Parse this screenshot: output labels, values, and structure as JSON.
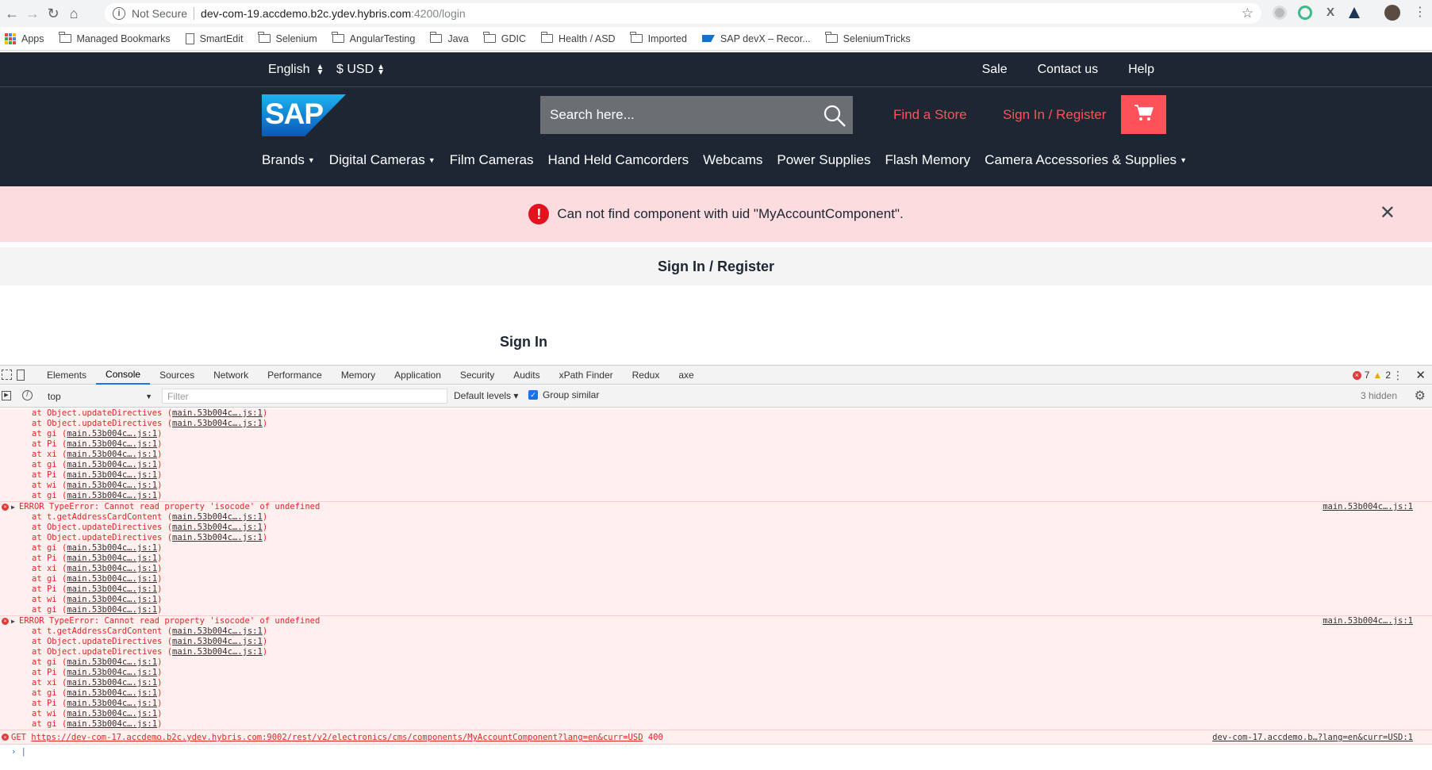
{
  "browser": {
    "security_label": "Not Secure",
    "url_host": "dev-com-19.accdemo.b2c.ydev.hybris.com",
    "url_path": ":4200/login",
    "bookmarks": [
      "Apps",
      "Managed Bookmarks",
      "SmartEdit",
      "Selenium",
      "AngularTesting",
      "Java",
      "GDIC",
      "Health / ASD",
      "Imported",
      "SAP devX – Recor...",
      "SeleniumTricks"
    ]
  },
  "site": {
    "language": "English",
    "currency": "$ USD",
    "top_links": [
      "Sale",
      "Contact us",
      "Help"
    ],
    "logo_text": "SAP",
    "search_placeholder": "Search here...",
    "find_store": "Find a Store",
    "sign_in_register": "Sign In / Register",
    "categories": [
      {
        "label": "Brands",
        "dropdown": true
      },
      {
        "label": "Digital Cameras",
        "dropdown": true
      },
      {
        "label": "Film Cameras",
        "dropdown": false
      },
      {
        "label": "Hand Held Camcorders",
        "dropdown": false
      },
      {
        "label": "Webcams",
        "dropdown": false
      },
      {
        "label": "Power Supplies",
        "dropdown": false
      },
      {
        "label": "Flash Memory",
        "dropdown": false
      },
      {
        "label": "Camera Accessories & Supplies",
        "dropdown": true
      }
    ],
    "alert_message": "Can not find component with uid \"MyAccountComponent\".",
    "page_title": "Sign In / Register",
    "section_heading": "Sign In"
  },
  "devtools": {
    "tabs": [
      "Elements",
      "Console",
      "Sources",
      "Network",
      "Performance",
      "Memory",
      "Application",
      "Security",
      "Audits",
      "xPath Finder",
      "Redux",
      "axe"
    ],
    "active_tab": "Console",
    "error_count": "7",
    "warning_count": "2",
    "context": "top",
    "filter_placeholder": "Filter",
    "levels": "Default levels ▾",
    "group_similar": "Group similar",
    "hidden": "3 hidden",
    "colors": {
      "error": "#e02828",
      "accent": "#1a73e8"
    },
    "console": {
      "partial_block": [
        {
          "fn": "Object.updateDirectives",
          "src": "main.53b004c….js:1"
        },
        {
          "fn": "Object.updateDirectives",
          "src": "main.53b004c….js:1"
        },
        {
          "fn": "gi",
          "src": "main.53b004c….js:1"
        },
        {
          "fn": "Pi",
          "src": "main.53b004c….js:1"
        },
        {
          "fn": "xi",
          "src": "main.53b004c….js:1"
        },
        {
          "fn": "gi",
          "src": "main.53b004c….js:1"
        },
        {
          "fn": "Pi",
          "src": "main.53b004c….js:1"
        },
        {
          "fn": "wi",
          "src": "main.53b004c….js:1"
        },
        {
          "fn": "gi",
          "src": "main.53b004c….js:1"
        }
      ],
      "errors": [
        {
          "message": "ERROR TypeError: Cannot read property 'isocode' of undefined",
          "source": "main.53b004c….js:1",
          "stack": [
            {
              "fn": "t.getAddressCardContent",
              "src": "main.53b004c….js:1"
            },
            {
              "fn": "Object.updateDirectives",
              "src": "main.53b004c….js:1"
            },
            {
              "fn": "Object.updateDirectives",
              "src": "main.53b004c….js:1"
            },
            {
              "fn": "gi",
              "src": "main.53b004c….js:1"
            },
            {
              "fn": "Pi",
              "src": "main.53b004c….js:1"
            },
            {
              "fn": "xi",
              "src": "main.53b004c….js:1"
            },
            {
              "fn": "gi",
              "src": "main.53b004c….js:1"
            },
            {
              "fn": "Pi",
              "src": "main.53b004c….js:1"
            },
            {
              "fn": "wi",
              "src": "main.53b004c….js:1"
            },
            {
              "fn": "gi",
              "src": "main.53b004c….js:1"
            }
          ]
        },
        {
          "message": "ERROR TypeError: Cannot read property 'isocode' of undefined",
          "source": "main.53b004c….js:1",
          "stack": [
            {
              "fn": "t.getAddressCardContent",
              "src": "main.53b004c….js:1"
            },
            {
              "fn": "Object.updateDirectives",
              "src": "main.53b004c….js:1"
            },
            {
              "fn": "Object.updateDirectives",
              "src": "main.53b004c….js:1"
            },
            {
              "fn": "gi",
              "src": "main.53b004c….js:1"
            },
            {
              "fn": "Pi",
              "src": "main.53b004c….js:1"
            },
            {
              "fn": "xi",
              "src": "main.53b004c….js:1"
            },
            {
              "fn": "gi",
              "src": "main.53b004c….js:1"
            },
            {
              "fn": "Pi",
              "src": "main.53b004c….js:1"
            },
            {
              "fn": "wi",
              "src": "main.53b004c….js:1"
            },
            {
              "fn": "gi",
              "src": "main.53b004c….js:1"
            }
          ]
        }
      ],
      "network_error": {
        "method": "GET",
        "url": "https://dev-com-17.accdemo.b2c.ydev.hybris.com:9002/rest/v2/electronics/cms/components/MyAccountComponent?lang=en&curr=USD",
        "status": "400",
        "source": "dev-com-17.accdemo.b…?lang=en&curr=USD:1"
      }
    }
  }
}
